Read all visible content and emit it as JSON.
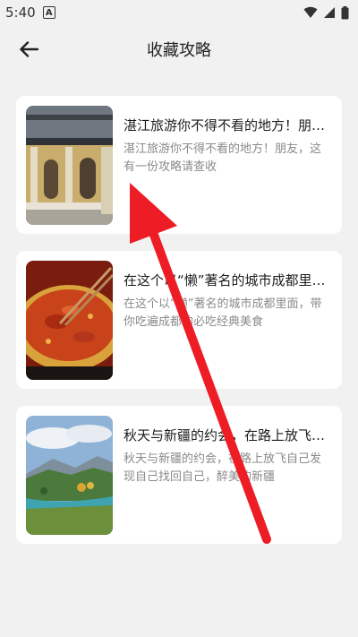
{
  "status_bar": {
    "time": "5:40",
    "notification_icon": "a-icon",
    "wifi_icon": "wifi-icon",
    "signal_icon": "signal-icon",
    "battery_icon": "battery-icon"
  },
  "header": {
    "back_icon": "back-arrow-icon",
    "title": "收藏攻略"
  },
  "cards": [
    {
      "title": "湛江旅游你不得不看的地方！朋友，这有一份攻略请查收",
      "desc": "湛江旅游你不得不看的地方！朋友，这有一份攻略请查收",
      "image": "colonial building"
    },
    {
      "title": "在这个以“懒”著名的城市成都里面，带你吃遍成都的必吃经典美食",
      "desc": "在这个以“懒”著名的城市成都里面，带你吃遍成都的必吃经典美食",
      "image": "hotpot"
    },
    {
      "title": "秋天与新疆的约会，在路上放飞自己发现自己找回自己，醉美的新疆",
      "desc": "秋天与新疆的约会，在路上放飞自己发现自己找回自己，醉美的新疆",
      "image": "xinjiang landscape"
    }
  ],
  "colors": {
    "background": "#f1f1f1",
    "card": "#ffffff",
    "annotation_arrow": "#ee1c25"
  }
}
